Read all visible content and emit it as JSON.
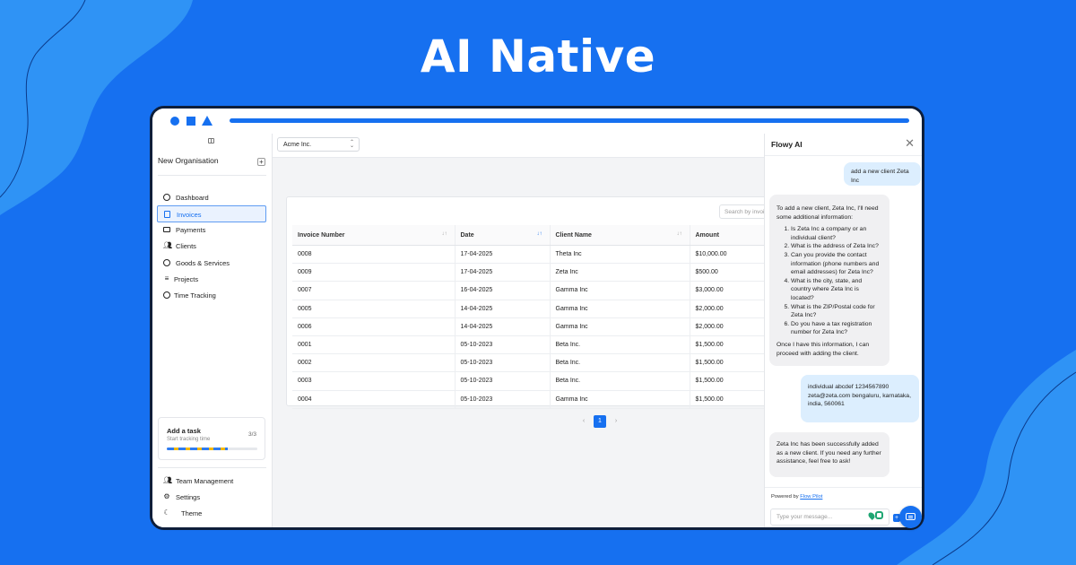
{
  "hero": {
    "title": "AI Native"
  },
  "colors": {
    "brand": "#1670f0",
    "window_frame": "#0e1e3a",
    "user_bubble": "#dceefe",
    "bot_bubble": "#f0f0f2",
    "progress_yellow": "#f5b800",
    "chat_icon_green": "#1fa673"
  },
  "sidebar": {
    "org_name": "New Organisation",
    "org_add_label": "+",
    "items": [
      {
        "label": "Dashboard",
        "icon": "gauge-icon",
        "active": false
      },
      {
        "label": "Invoices",
        "icon": "document-icon",
        "active": true
      },
      {
        "label": "Payments",
        "icon": "cash-icon",
        "active": false
      },
      {
        "label": "Clients",
        "icon": "users-icon",
        "active": false
      },
      {
        "label": "Goods & Services",
        "icon": "box-icon",
        "active": false
      },
      {
        "label": "Projects",
        "icon": "list-icon",
        "active": false
      },
      {
        "label": "Time Tracking",
        "icon": "clock-icon",
        "active": false
      }
    ],
    "task_card": {
      "title": "Add a task",
      "subtitle": "Start tracking time",
      "count": "3/3",
      "progress_fraction": 0.67
    },
    "bottom_items": [
      {
        "label": "Team Management",
        "icon": "users-icon"
      },
      {
        "label": "Settings",
        "icon": "gear-icon"
      },
      {
        "label": "Theme",
        "icon": "moon-icon"
      }
    ]
  },
  "main": {
    "org_select": {
      "value": "Acme Inc.",
      "chevron": "⌃⌄"
    },
    "search_placeholder": "Search by invoice",
    "table": {
      "columns": [
        "Invoice Number",
        "Date",
        "Client Name",
        "Amount"
      ],
      "sort_icons": [
        "↓↑",
        "↓↑",
        "↓↑"
      ],
      "rows": [
        [
          "0008",
          "17-04-2025",
          "Theta Inc",
          "$10,000.00"
        ],
        [
          "0009",
          "17-04-2025",
          "Zeta Inc",
          "$500.00"
        ],
        [
          "0007",
          "16-04-2025",
          "Gamma Inc",
          "$3,000.00"
        ],
        [
          "0005",
          "14-04-2025",
          "Gamma Inc",
          "$2,000.00"
        ],
        [
          "0006",
          "14-04-2025",
          "Gamma Inc",
          "$2,000.00"
        ],
        [
          "0001",
          "05-10-2023",
          "Beta Inc.",
          "$1,500.00"
        ],
        [
          "0002",
          "05-10-2023",
          "Beta Inc.",
          "$1,500.00"
        ],
        [
          "0003",
          "05-10-2023",
          "Beta Inc.",
          "$1,500.00"
        ],
        [
          "0004",
          "05-10-2023",
          "Gamma Inc",
          "$1,500.00"
        ]
      ]
    },
    "pagination": {
      "prev": "‹",
      "current": "1",
      "next": "›"
    }
  },
  "chat": {
    "title": "Flowy AI",
    "close_label": "✕",
    "messages": {
      "user1": "add a new client Zeta Inc",
      "bot1_intro": "To add a new client, Zeta Inc, I'll need some additional information:",
      "bot1_questions": [
        "Is Zeta Inc a company or an individual client?",
        "What is the address of Zeta Inc?",
        "Can you provide the contact information (phone numbers and email addresses) for Zeta Inc?",
        "What is the city, state, and country where Zeta Inc is located?",
        "What is the ZIP/Postal code for Zeta Inc?",
        "Do you have a tax registration number for Zeta Inc?"
      ],
      "bot1_outro": "Once I have this information, I can proceed with adding the client.",
      "user2": "individual abcdef 1234567890 zeta@zeta.com bengaluru, karnataka, india, 560061",
      "bot2": "Zeta Inc has been successfully added as a new client. If you need any further assistance, feel free to ask!"
    },
    "powered_prefix": "Powered by",
    "powered_link": "Flow Pilot",
    "input_placeholder": "Type your message...",
    "send_label": "+"
  }
}
